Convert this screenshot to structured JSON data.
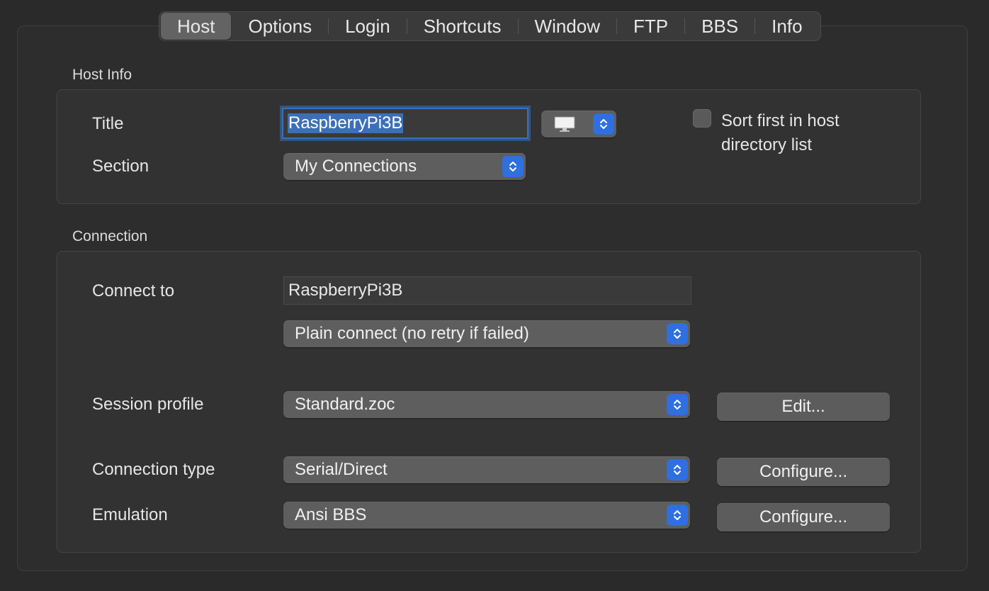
{
  "tabs": [
    "Host",
    "Options",
    "Login",
    "Shortcuts",
    "Window",
    "FTP",
    "BBS",
    "Info"
  ],
  "active_tab": "Host",
  "host_info": {
    "group_label": "Host Info",
    "title_label": "Title",
    "title_value": "RaspberryPi3B",
    "icon_popup": "monitor-icon",
    "section_label": "Section",
    "section_value": "My Connections",
    "sort_checkbox_label_line1": "Sort first in host",
    "sort_checkbox_label_line2": "directory list",
    "sort_checked": false
  },
  "connection": {
    "group_label": "Connection",
    "connect_to_label": "Connect to",
    "connect_to_value": "RaspberryPi3B",
    "connect_mode": "Plain connect (no retry if failed)",
    "session_profile_label": "Session profile",
    "session_profile_value": "Standard.zoc",
    "edit_button": "Edit...",
    "connection_type_label": "Connection type",
    "connection_type_value": "Serial/Direct",
    "configure_button_1": "Configure...",
    "emulation_label": "Emulation",
    "emulation_value": "Ansi BBS",
    "configure_button_2": "Configure..."
  },
  "colors": {
    "background": "#2a2a2a",
    "accent": "#2f6fe0",
    "focus_ring": "#3a6fbe"
  }
}
